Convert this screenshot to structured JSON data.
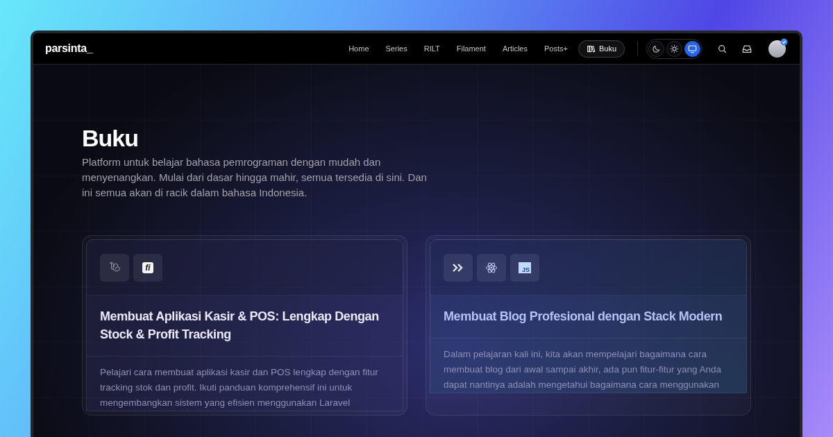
{
  "brand": "parsinta_",
  "nav": [
    {
      "label": "Home",
      "selected": false
    },
    {
      "label": "Series",
      "selected": false
    },
    {
      "label": "RILT",
      "selected": false
    },
    {
      "label": "Filament",
      "selected": false
    },
    {
      "label": "Articles",
      "selected": false
    },
    {
      "label": "Posts+",
      "selected": false
    },
    {
      "label": "Buku",
      "selected": true,
      "kind": "book"
    }
  ],
  "theme_modes": [
    {
      "kind": "dark",
      "selected": false
    },
    {
      "kind": "light",
      "selected": false
    },
    {
      "kind": "system",
      "selected": true
    }
  ],
  "user": {
    "verified": true
  },
  "page": {
    "title": "Buku",
    "description": "Platform untuk belajar bahasa pemrograman dengan mudah dan menyenangkan. Mulai dari dasar hingga mahir, semua tersedia di sini. Dan ini semua akan di racik dalam bahasa Indonesia."
  },
  "books": [
    {
      "tech": [
        {
          "kind": "cube"
        },
        {
          "kind": "badge",
          "label": "fi"
        }
      ],
      "title": "Membuat Aplikasi Kasir & POS: Lengkap Dengan Stock & Profit Tracking",
      "description": "Pelajari cara membuat aplikasi kasir dan POS lengkap dengan fitur tracking stok dan profit. Ikuti panduan komprehensif ini untuk mengembangkan sistem yang efisien menggunakan Laravel"
    },
    {
      "tech": [
        {
          "kind": "chevrons"
        },
        {
          "kind": "atom"
        },
        {
          "kind": "square",
          "label": "JS"
        }
      ],
      "title": "Membuat Blog Profesional dengan Stack Modern",
      "description": "Dalam pelajaran kali ini, kita akan mempelajari bagaimana cara membuat blog dari awal sampai akhir, ada pun fitur-fitur yang Anda dapat nantinya adalah mengetahui bagaimana cara menggunakan"
    }
  ]
}
